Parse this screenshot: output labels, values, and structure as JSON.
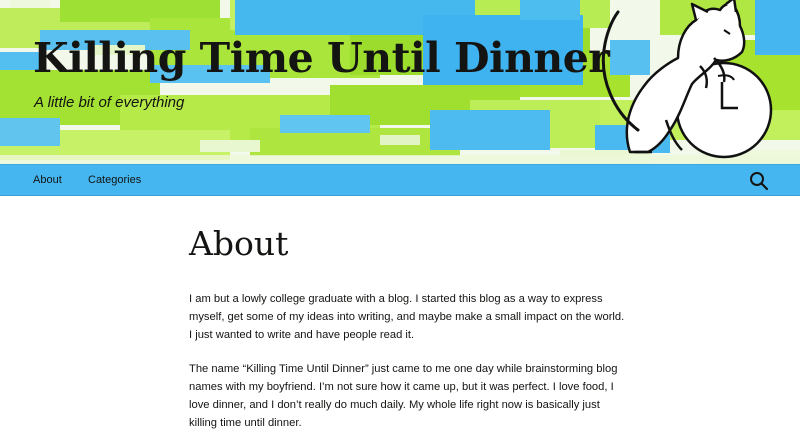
{
  "site": {
    "title": "Killing Time Until Dinner",
    "tagline": "A little bit of everything"
  },
  "nav": {
    "items": [
      {
        "label": "About"
      },
      {
        "label": "Categories"
      }
    ],
    "search_icon": "search-icon"
  },
  "page": {
    "title": "About",
    "paragraphs": [
      "I am but a lowly college graduate with a blog. I started this blog as a way to express myself, get some of my ideas into writing, and maybe make a small impact on the world. I just wanted to write and have people read it.",
      "The name “Killing Time Until Dinner” just came to me one day while brainstorming blog names with my boyfriend. I’m not sure how it came up, but it was perfect. I love food, I love dinner, and I don’t really do much daily. My whole life right now is basically just killing time until dinner."
    ]
  },
  "colors": {
    "nav_bg": "#45b6f0",
    "header_green": "#a6e22e",
    "header_blue": "#3fb2f0",
    "text": "#141412"
  }
}
